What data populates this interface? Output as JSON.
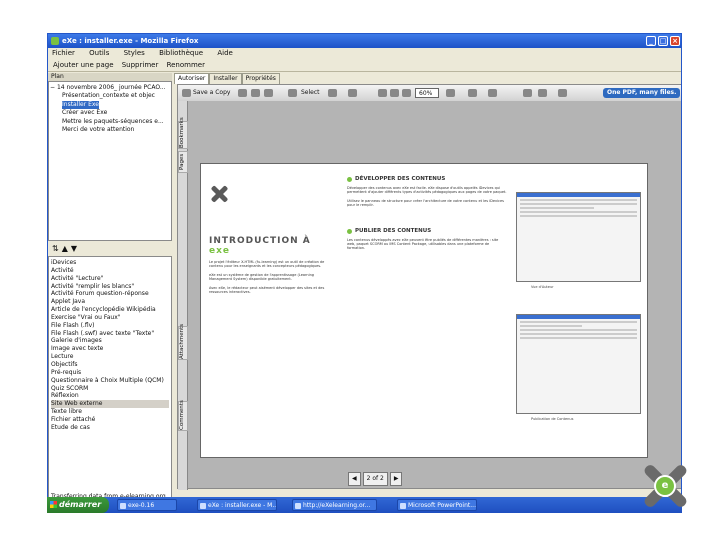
{
  "window": {
    "title": "eXe : installer.exe - Mozilla Firefox"
  },
  "menu": [
    "Fichier",
    "Outils",
    "Styles",
    "Bibliothèque",
    "Aide"
  ],
  "toolbar": [
    "Ajouter une page",
    "Supprimer",
    "Renommer"
  ],
  "outline": {
    "tab": "Plan",
    "items": [
      "14 novembre 2006_ journée PCAO...",
      "Présentation_contexte et objec",
      "Installer Exe",
      "Créer avec Exe",
      "Mettre les paquets-séquences e...",
      "Merci de votre attention"
    ],
    "selected_index": 2
  },
  "idevices": {
    "header": "iDevices",
    "items": [
      "Activité",
      "Activité \"Lecture\"",
      "Activité \"remplir les blancs\"",
      "Activité Forum question-réponse",
      "Applet Java",
      "Article de l'encyclopédie Wikipédia",
      "Exercise \"Vrai ou Faux\"",
      "File Flash (.flv)",
      "File Flash (.swf) avec texte \"Texte\"",
      "Galerie d'images",
      "Image avec texte",
      "Lecture",
      "Objectifs",
      "Pré-requis",
      "Questionnaire à Choix Multiple (QCM)",
      "Quiz SCORM",
      "Réflexion",
      "Site Web externe",
      "Texte libre",
      "Fichier attaché",
      "Étude de cas"
    ],
    "highlight_index": 17
  },
  "tabs": [
    "Autoriser",
    "Installer",
    "Propriétés"
  ],
  "viewer": {
    "save": "Save a Copy",
    "select": "Select",
    "zoom": "60%",
    "promo": "One PDF, many files.",
    "side_tabs": [
      "Pages",
      "Bookmarks",
      "Attachments",
      "Comments"
    ],
    "page_indicator": "2 of 2"
  },
  "document": {
    "heading": "INTRODUCTION À ",
    "heading_brand": "exe",
    "col1": [
      "Le projet l'éditeur X-HTML (fu-learning) est un outil de création de contenu pour les enseignants et les concepteurs pédagogiques.",
      "eXe est un système de gestion de l'apprentissage (Learning Management System) disponible gratuitement.",
      "Avec eXe, le rédacteur peut aisément développer des sites et des ressources interactives."
    ],
    "sec1": "DÉVELOPPER DES CONTENUS",
    "col2a": [
      "Développer des contenus avec eXe est facile. eXe dispose d'outils appelés iDevices qui permettent d'ajouter différents types d'activités pédagogiques aux pages de votre paquet.",
      "Utilisez le panneau de structure pour créer l'architecture de votre contenu et les iDevices pour le remplir."
    ],
    "sec2": "PUBLIER DES CONTENUS",
    "col2b": [
      "Les contenus développés avec eXe peuvent être publiés de différentes manières : site web, paquet SCORM ou IMS Content Package, utilisables dans une plateforme de formation."
    ],
    "captions": [
      "Vue d'Auteur",
      "Publication de Contenus"
    ]
  },
  "status": "Transferring data from e-elearning.org...",
  "taskbar": {
    "start": "démarrer",
    "tasks": [
      "exe-0.16",
      "eXe : installer.exe - M...",
      "http://eXelearning.or...",
      "Microsoft PowerPoint..."
    ]
  }
}
